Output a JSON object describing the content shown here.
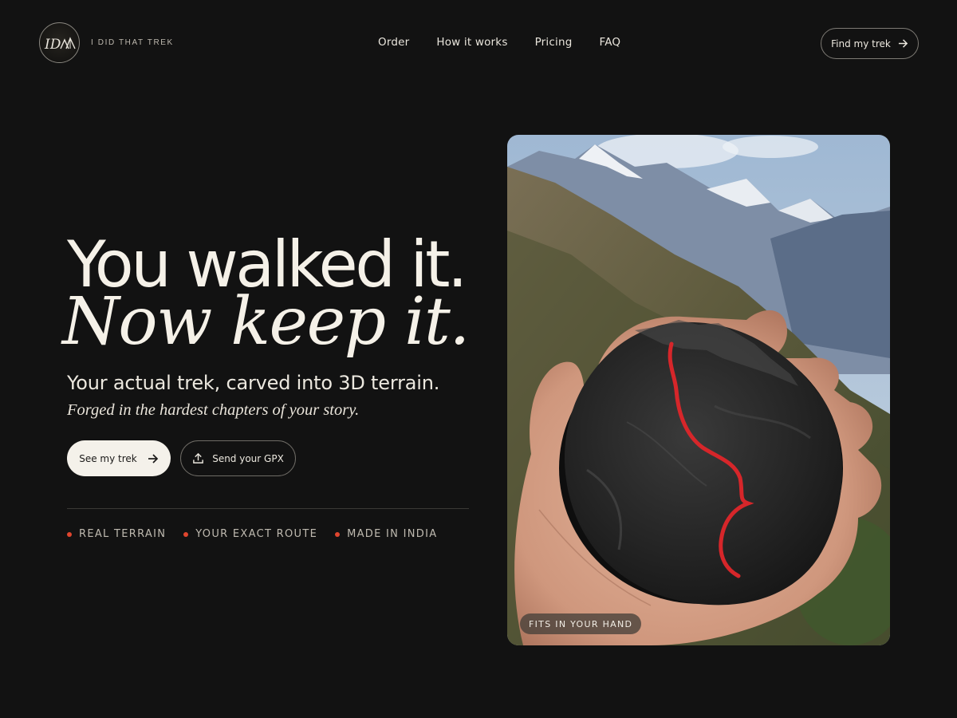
{
  "brand": {
    "mark_text": "ID",
    "name": "I DID THAT TREK",
    "logo_icon": "mountain-logo-icon"
  },
  "nav": {
    "items": [
      {
        "label": "Order"
      },
      {
        "label": "How it works"
      },
      {
        "label": "Pricing"
      },
      {
        "label": "FAQ"
      }
    ]
  },
  "header_cta": {
    "label": "Find my trek",
    "icon": "arrow-right-icon"
  },
  "hero": {
    "title_line1": "You walked it.",
    "title_line2": "Now keep it.",
    "subtitle": "Your actual trek, carved into 3D terrain.",
    "tagline": "Forged in the hardest chapters of your story.",
    "primary_button": {
      "label": "See my trek",
      "icon": "arrow-right-icon"
    },
    "secondary_button": {
      "label": "Send your GPX",
      "icon": "upload-icon"
    },
    "features": [
      {
        "label": "REAL TERRAIN"
      },
      {
        "label": "YOUR EXACT ROUTE"
      },
      {
        "label": "MADE IN INDIA"
      }
    ]
  },
  "photo": {
    "badge": "FITS IN YOUR HAND",
    "subject": "hand-holding-3d-terrain-model"
  },
  "colors": {
    "background": "#121212",
    "text": "#f3efe6",
    "accent_dot": "#e0452e",
    "route_red": "#d6262a",
    "primary_button_bg": "#f4f1ea"
  }
}
